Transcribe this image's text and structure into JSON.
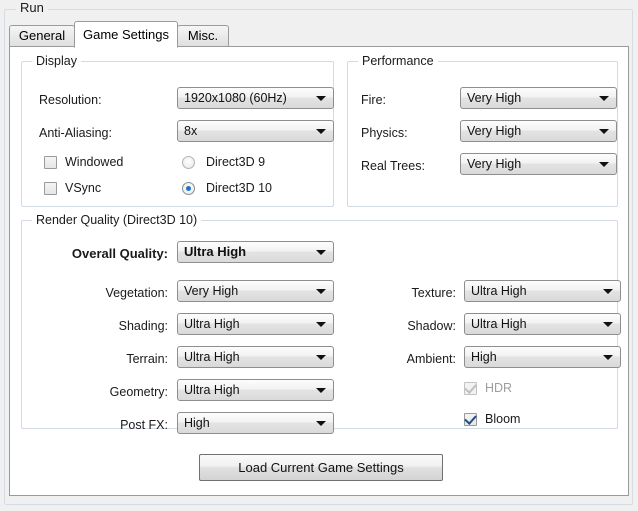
{
  "window": {
    "outer_group_title": "Run"
  },
  "tabs": [
    {
      "label": "General",
      "selected": false
    },
    {
      "label": "Game Settings",
      "selected": true
    },
    {
      "label": "Misc.",
      "selected": false
    }
  ],
  "display": {
    "title": "Display",
    "resolution_label": "Resolution:",
    "resolution_value": "1920x1080 (60Hz)",
    "antialiasing_label": "Anti-Aliasing:",
    "antialiasing_value": "8x",
    "windowed_label": "Windowed",
    "windowed_checked": false,
    "vsync_label": "VSync",
    "vsync_checked": false,
    "direct3d9_label": "Direct3D 9",
    "direct3d9_selected": false,
    "direct3d10_label": "Direct3D 10",
    "direct3d10_selected": true
  },
  "performance": {
    "title": "Performance",
    "rows": [
      {
        "label": "Fire:",
        "value": "Very High"
      },
      {
        "label": "Physics:",
        "value": "Very High"
      },
      {
        "label": "Real Trees:",
        "value": "Very High"
      }
    ]
  },
  "render_quality": {
    "title": "Render Quality (Direct3D 10)",
    "overall_label": "Overall Quality:",
    "overall_value": "Ultra High",
    "left_rows": [
      {
        "label": "Vegetation:",
        "value": "Very High"
      },
      {
        "label": "Shading:",
        "value": "Ultra High"
      },
      {
        "label": "Terrain:",
        "value": "Ultra High"
      },
      {
        "label": "Geometry:",
        "value": "Ultra High"
      },
      {
        "label": "Post FX:",
        "value": "High"
      }
    ],
    "right_rows": [
      {
        "label": "Texture:",
        "value": "Ultra High"
      },
      {
        "label": "Shadow:",
        "value": "Ultra High"
      },
      {
        "label": "Ambient:",
        "value": "High"
      }
    ],
    "hdr_label": "HDR",
    "hdr_checked": true,
    "hdr_disabled": true,
    "bloom_label": "Bloom",
    "bloom_checked": true,
    "bloom_disabled": false
  },
  "actions": {
    "load_button_label": "Load Current Game Settings"
  },
  "colors": {
    "window_background": "#f0f0f0",
    "panel_background": "#ffffff",
    "group_border": "#d3dae3",
    "tab_border": "#9a9a9a",
    "radio_accent": "#1c74c4",
    "check_accent": "#1f4f82",
    "disabled_text": "#9e9e9e"
  }
}
